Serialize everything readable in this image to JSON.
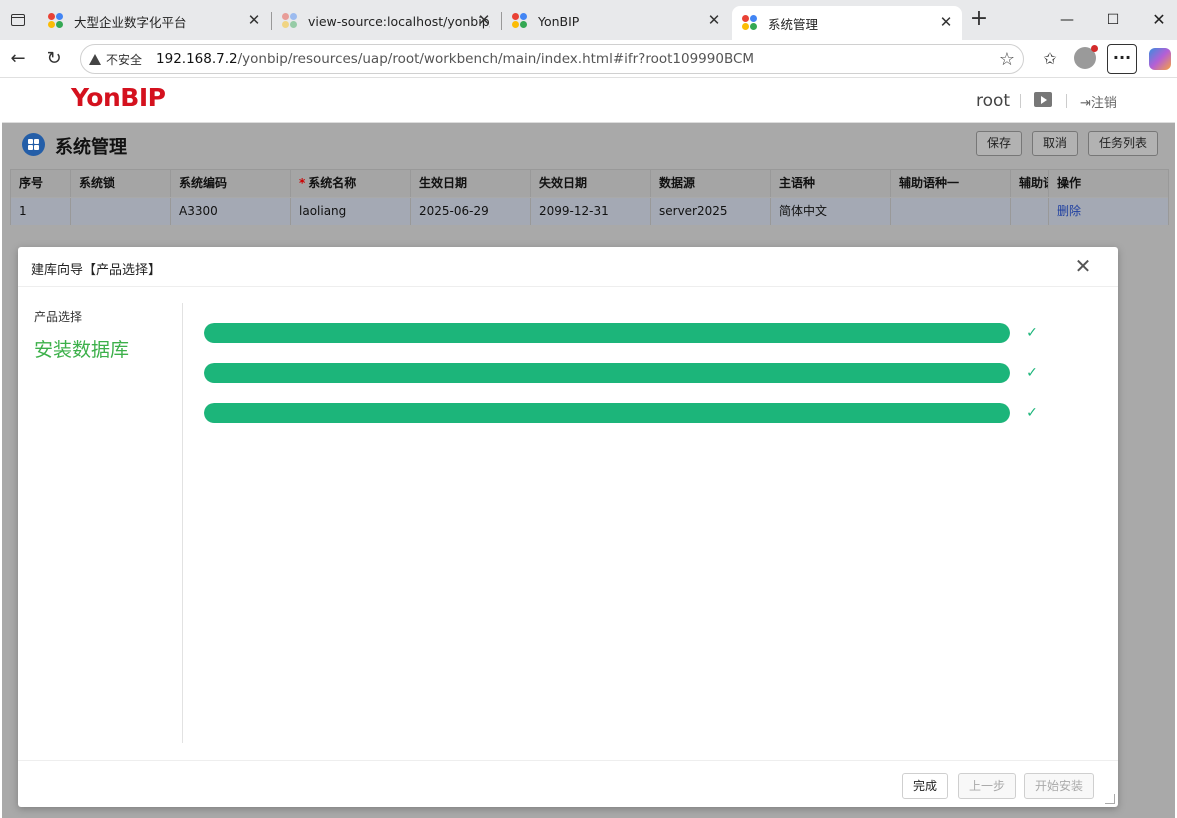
{
  "browser": {
    "tabs": [
      {
        "title": "大型企业数字化平台",
        "active": false
      },
      {
        "title": "view-source:localhost/yonbip/re",
        "active": false
      },
      {
        "title": "YonBIP",
        "active": false
      },
      {
        "title": "系统管理",
        "active": true
      }
    ],
    "new_tab": "+",
    "security_label": "不安全",
    "url_host": "192.168.7.2",
    "url_path": "/yonbip/resources/uap/root/workbench/main/index.html#ifr?root109990BCM",
    "more_label": "···"
  },
  "app": {
    "logo": "YonBIP",
    "user": "root",
    "logout": "注销"
  },
  "page": {
    "title": "系统管理",
    "buttons": [
      "保存",
      "取消",
      "任务列表"
    ],
    "grid": {
      "columns": [
        {
          "label": "序号",
          "required": false
        },
        {
          "label": "系统锁",
          "required": false
        },
        {
          "label": "系统编码",
          "required": false
        },
        {
          "label": "系统名称",
          "required": true
        },
        {
          "label": "生效日期",
          "required": false
        },
        {
          "label": "失效日期",
          "required": false
        },
        {
          "label": "数据源",
          "required": false
        },
        {
          "label": "主语种",
          "required": false
        },
        {
          "label": "辅助语种一",
          "required": false
        },
        {
          "label": "辅助语",
          "required": false
        },
        {
          "label": "操作",
          "required": false
        }
      ],
      "required_mark": "*",
      "rows": [
        [
          "1",
          "",
          "A3300",
          "laoliang",
          "2025-06-29",
          "2099-12-31",
          "server2025",
          "简体中文",
          "",
          "",
          "删除"
        ]
      ]
    }
  },
  "dialog": {
    "title": "建库向导【产品选择】",
    "steps": [
      "产品选择",
      "安装数据库"
    ],
    "progress": [
      {
        "percent": 100,
        "done": true
      },
      {
        "percent": 100,
        "done": true
      },
      {
        "percent": 100,
        "done": true
      }
    ],
    "check_glyph": "✓",
    "footer_buttons": [
      {
        "label": "完成",
        "enabled": true
      },
      {
        "label": "上一步",
        "enabled": false
      },
      {
        "label": "开始安装",
        "enabled": false
      }
    ]
  },
  "colors": {
    "progress": "#1cb57a",
    "step_active": "#3cb04a",
    "logo": "#d4111e",
    "link": "#1d3ea0"
  }
}
